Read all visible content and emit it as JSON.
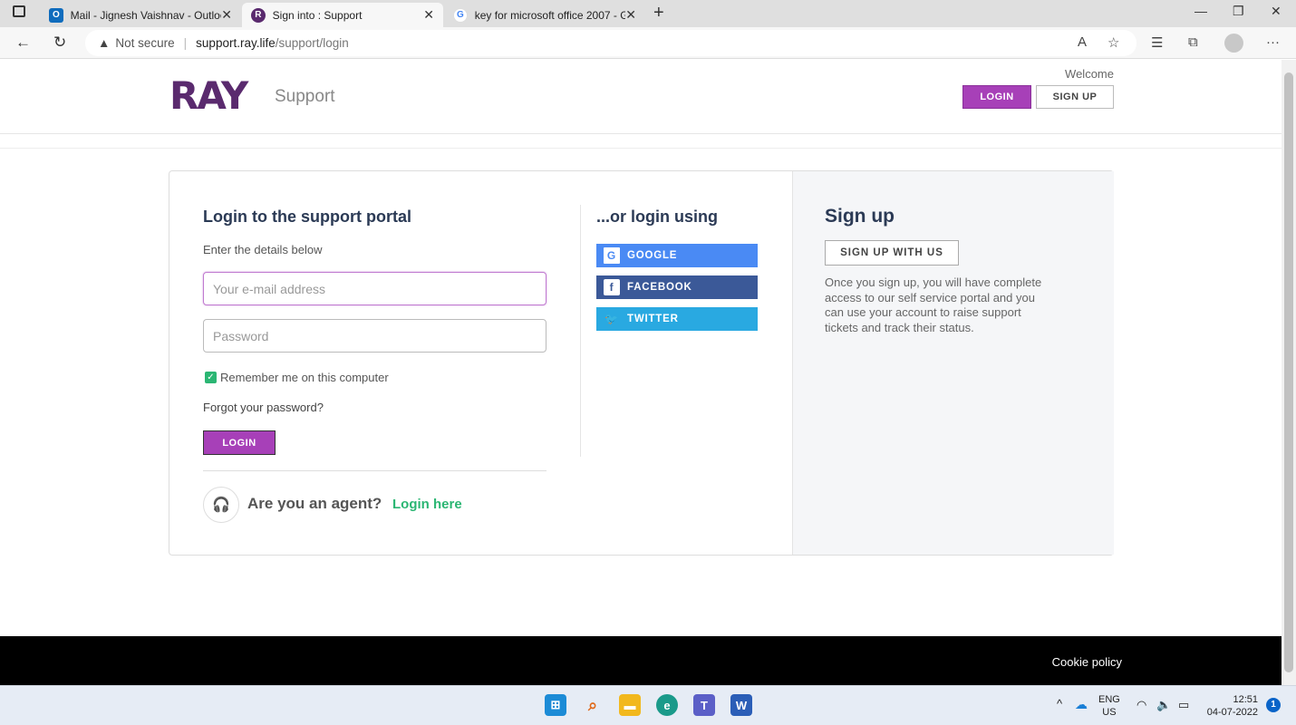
{
  "browser": {
    "tabs": [
      {
        "title": "Mail - Jignesh Vaishnav - Outloo",
        "active": false
      },
      {
        "title": "Sign into : Support",
        "active": true
      },
      {
        "title": "key for microsoft office 2007 - G",
        "active": false
      }
    ],
    "address": {
      "security": "Not secure",
      "host": "support.ray.life",
      "path": "/support/login"
    }
  },
  "header": {
    "logo": "RAY",
    "support_label": "Support",
    "welcome": "Welcome",
    "login_label": "LOGIN",
    "signup_label": "SIGN UP"
  },
  "login": {
    "title": "Login to the support portal",
    "subtitle": "Enter the details below",
    "email_placeholder": "Your e-mail address",
    "password_placeholder": "Password",
    "remember_label": "Remember me on this computer",
    "remember_checked": true,
    "forgot_label": "Forgot your password?",
    "login_button": "LOGIN",
    "agent_question": "Are you an agent?",
    "agent_link": "Login here"
  },
  "social": {
    "title": "...or login using",
    "buttons": [
      {
        "label": "GOOGLE",
        "color": "#4a8af4"
      },
      {
        "label": "FACEBOOK",
        "color": "#3b5998"
      },
      {
        "label": "TWITTER",
        "color": "#29a9e1"
      }
    ]
  },
  "signup": {
    "title": "Sign up",
    "button": "SIGN UP WITH US",
    "text": "Once you sign up, you will have complete access to our self service portal and you can use your account to raise support tickets and track their status."
  },
  "footer": {
    "cookie_policy": "Cookie policy"
  },
  "taskbar": {
    "lang": "ENG",
    "region": "US",
    "time": "12:51",
    "date": "04-07-2022",
    "notification_count": "1"
  },
  "colors": {
    "accent": "#a740b8",
    "agent_link": "#2bb673",
    "heading": "#2b3a55"
  }
}
